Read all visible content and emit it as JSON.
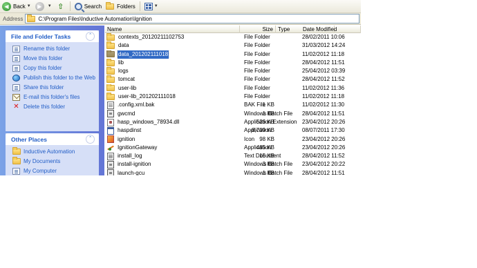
{
  "toolbar": {
    "back_label": "Back",
    "search_label": "Search",
    "folders_label": "Folders"
  },
  "address": {
    "label": "Address",
    "path": "C:\\Program Files\\Inductive Automation\\Ignition"
  },
  "file_tasks": {
    "title": "File and Folder Tasks",
    "items": [
      {
        "label": "Rename this folder",
        "icon": "rename-icon"
      },
      {
        "label": "Move this folder",
        "icon": "move-icon"
      },
      {
        "label": "Copy this folder",
        "icon": "copy-icon"
      },
      {
        "label": "Publish this folder to the Web",
        "icon": "publish-web-icon"
      },
      {
        "label": "Share this folder",
        "icon": "share-icon"
      },
      {
        "label": "E-mail this folder's files",
        "icon": "email-icon"
      },
      {
        "label": "Delete this folder",
        "icon": "delete-icon"
      }
    ]
  },
  "other_places": {
    "title": "Other Places",
    "items": [
      {
        "label": "Inductive Automation",
        "icon": "folder-icon"
      },
      {
        "label": "My Documents",
        "icon": "my-documents-icon"
      },
      {
        "label": "My Computer",
        "icon": "my-computer-icon"
      }
    ]
  },
  "columns": {
    "name": "Name",
    "size": "Size",
    "type": "Type",
    "date": "Date Modified"
  },
  "files": [
    {
      "name": "contexts_20120211102753",
      "size": "",
      "type": "File Folder",
      "date": "28/02/2011 10:06",
      "icon": "folder-icon"
    },
    {
      "name": "data",
      "size": "",
      "type": "File Folder",
      "date": "31/03/2012 14:24",
      "icon": "folder-icon"
    },
    {
      "name": "data_201202111018",
      "size": "",
      "type": "File Folder",
      "date": "11/02/2012 11:18",
      "icon": "folder-icon",
      "selected": true
    },
    {
      "name": "lib",
      "size": "",
      "type": "File Folder",
      "date": "28/04/2012 11:51",
      "icon": "folder-icon"
    },
    {
      "name": "logs",
      "size": "",
      "type": "File Folder",
      "date": "25/04/2012 03:39",
      "icon": "folder-icon"
    },
    {
      "name": "tomcat",
      "size": "",
      "type": "File Folder",
      "date": "28/04/2012 11:52",
      "icon": "folder-icon"
    },
    {
      "name": "user-lib",
      "size": "",
      "type": "File Folder",
      "date": "11/02/2012 11:36",
      "icon": "folder-icon"
    },
    {
      "name": "user-lib_201202111018",
      "size": "",
      "type": "File Folder",
      "date": "11/02/2012 11:18",
      "icon": "folder-icon"
    },
    {
      "name": ".config.xml.bak",
      "size": "1 KB",
      "type": "BAK File",
      "date": "11/02/2012 11:30",
      "icon": "bak-file-icon"
    },
    {
      "name": "gwcmd",
      "size": "1 KB",
      "type": "Windows Batch File",
      "date": "28/04/2012 11:51",
      "icon": "batch-file-icon"
    },
    {
      "name": "hasp_windows_78934.dll",
      "size": "526 KB",
      "type": "Application Extension",
      "date": "23/04/2012 20:26",
      "icon": "dll-file-icon"
    },
    {
      "name": "haspdinst",
      "size": "8,709 KB",
      "type": "Application",
      "date": "08/07/2011 17:30",
      "icon": "application-icon"
    },
    {
      "name": "ignition",
      "size": "98 KB",
      "type": "Icon",
      "date": "23/04/2012 20:26",
      "icon": "icon-file-icon"
    },
    {
      "name": "IgnitionGateway",
      "size": "485 KB",
      "type": "Application",
      "date": "23/04/2012 20:26",
      "icon": "gateway-app-icon"
    },
    {
      "name": "install_log",
      "size": "15 KB",
      "type": "Text Document",
      "date": "28/04/2012 11:52",
      "icon": "text-file-icon"
    },
    {
      "name": "install-ignition",
      "size": "3 KB",
      "type": "Windows Batch File",
      "date": "23/04/2012 20:22",
      "icon": "batch-file-icon"
    },
    {
      "name": "launch-gcu",
      "size": "1 KB",
      "type": "Windows Batch File",
      "date": "28/04/2012 11:51",
      "icon": "batch-file-icon"
    }
  ]
}
